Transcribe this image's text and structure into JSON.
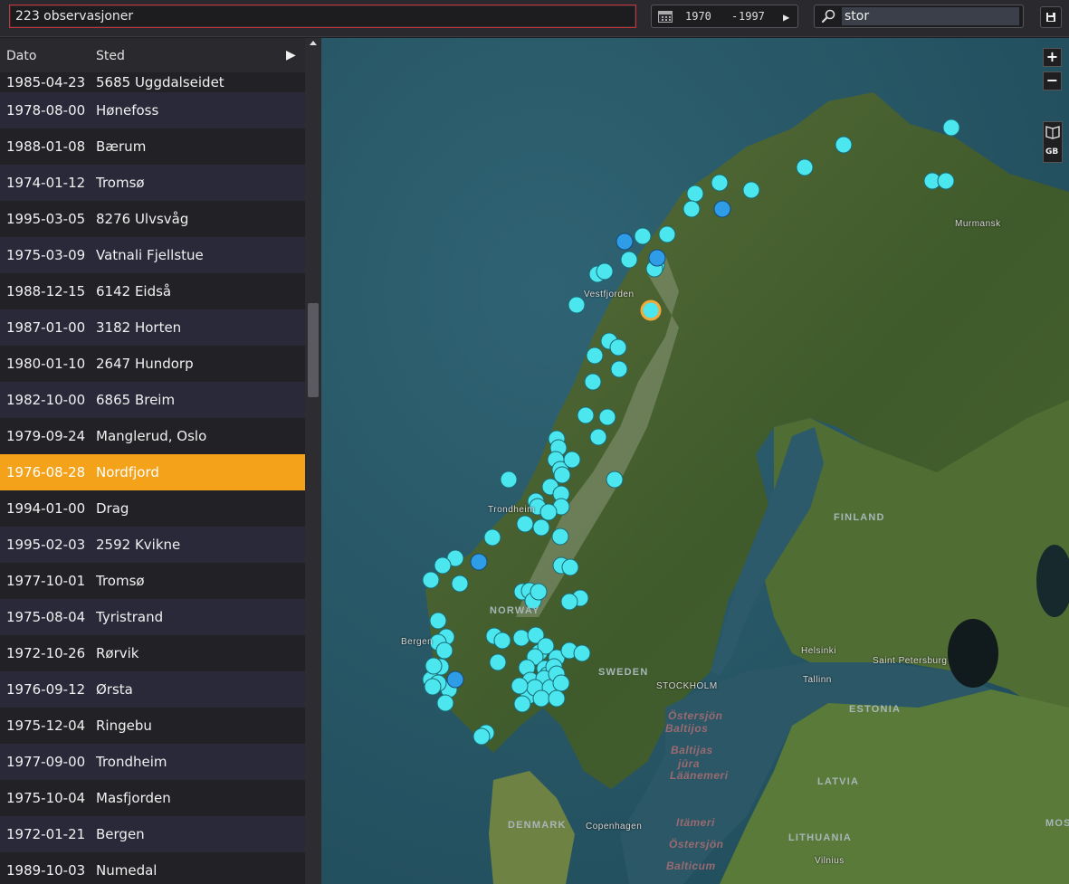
{
  "topbar": {
    "count_text": "223 observasjoner",
    "year_from": "1970",
    "year_sep": "-",
    "year_to": "1997",
    "year_play": "▶",
    "search_value": "stor"
  },
  "table": {
    "headers": {
      "date": "Dato",
      "place": "Sted",
      "play": "▶"
    },
    "rows": [
      {
        "date": "1985-04-23",
        "place": "5685 Uggdalseidet"
      },
      {
        "date": "1978-08-00",
        "place": "Hønefoss"
      },
      {
        "date": "1988-01-08",
        "place": "Bærum"
      },
      {
        "date": "1974-01-12",
        "place": "Tromsø"
      },
      {
        "date": "1995-03-05",
        "place": "8276 Ulvsvåg"
      },
      {
        "date": "1975-03-09",
        "place": "Vatnali Fjellstue"
      },
      {
        "date": "1988-12-15",
        "place": "6142 Eidså"
      },
      {
        "date": "1987-01-00",
        "place": "3182 Horten"
      },
      {
        "date": "1980-01-10",
        "place": "2647 Hundorp"
      },
      {
        "date": "1982-10-00",
        "place": "6865 Breim"
      },
      {
        "date": "1979-09-24",
        "place": "Manglerud, Oslo"
      },
      {
        "date": "1976-08-28",
        "place": "Nordfjord",
        "selected": true
      },
      {
        "date": "1994-01-00",
        "place": "Drag"
      },
      {
        "date": "1995-02-03",
        "place": "2592 Kvikne"
      },
      {
        "date": "1977-10-01",
        "place": "Tromsø"
      },
      {
        "date": "1975-08-04",
        "place": "Tyristrand"
      },
      {
        "date": "1972-10-26",
        "place": "Rørvik"
      },
      {
        "date": "1976-09-12",
        "place": "Ørsta"
      },
      {
        "date": "1975-12-04",
        "place": "Ringebu"
      },
      {
        "date": "1977-09-00",
        "place": "Trondheim"
      },
      {
        "date": "1975-10-04",
        "place": "Masfjorden"
      },
      {
        "date": "1972-01-21",
        "place": "Bergen"
      },
      {
        "date": "1989-10-03",
        "place": "Numedal"
      }
    ]
  },
  "map": {
    "zoom_in": "+",
    "zoom_out": "−",
    "layer_label": "GB",
    "labels": {
      "finland": "FINLAND",
      "sweden": "SWEDEN",
      "norway": "NORWAY",
      "estonia": "ESTONIA",
      "latvia": "LATVIA",
      "lithuania": "LITHUANIA",
      "denmark": "DENMARK",
      "vestfjorden": "Vestfjorden",
      "murmansk": "Murmansk",
      "helsinki": "Helsinki",
      "saint_petersburg": "Saint Petersburg",
      "tallinn": "Tallinn",
      "stockholm": "STOCKHOLM",
      "trondheim": "Trondheim",
      "bergen": "Bergen",
      "copenhagen": "Copenhagen",
      "vilnius": "Vilnius",
      "mos": "MOS",
      "baltic_1": "Östersjön",
      "baltic_2": "Baltijas",
      "baltic_3": "jūra",
      "baltic_4": "Läänemeri",
      "baltic_5": "Itämeri",
      "baltic_6": "Baltijos",
      "baltic_7": "jūra",
      "baltic_8": "Östersjön",
      "baltic_9": "Balticum"
    },
    "colors": {
      "marker": "#4ce6ee",
      "marker_dark": "#2f9ce8",
      "marker_selected_ring": "#f2a93a",
      "land": "#4f6a33",
      "sea": "#2c5868"
    }
  }
}
